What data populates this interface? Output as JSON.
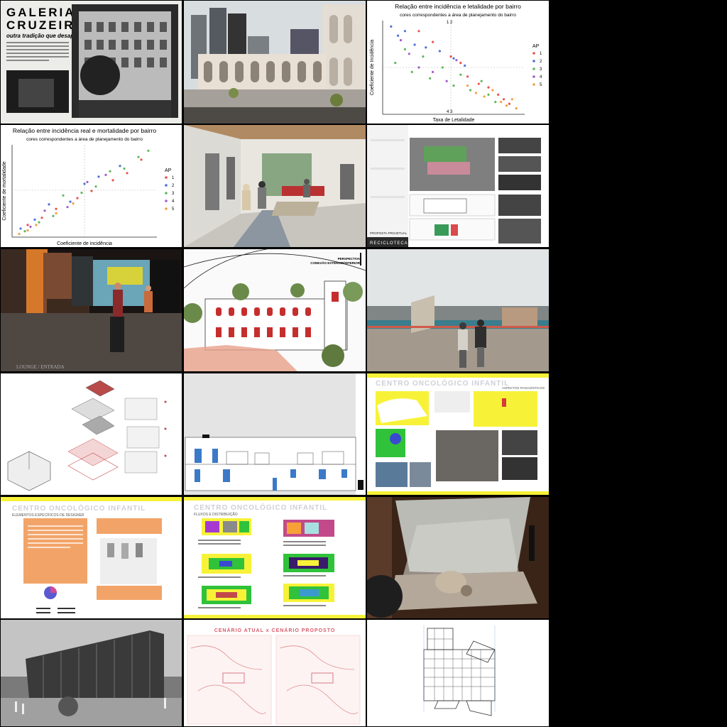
{
  "tiles": {
    "galeria": {
      "title_line1": "GALERIA",
      "title_line2": "CRUZEIRO",
      "subtitle": "outra tradição que desaparece"
    },
    "chart1": {
      "title": "Relação entre incidência e letalidade por bairro",
      "subtitle": "cores correspondentes a área de planejamento do bairro",
      "xlabel": "Taxa de Letalidade",
      "ylabel": "Coeficiente de Incidência",
      "quad_top": "1   2",
      "quad_bottom": "4   3",
      "legend_title": "AP",
      "legend": [
        "1",
        "2",
        "3",
        "4",
        "5"
      ]
    },
    "chart2": {
      "title": "Relação entre incidência real e mortalidade por bairro",
      "subtitle": "cores correspondentes a área de planejamento do bairro",
      "xlabel": "Coeficiente de incidência",
      "ylabel": "Coeficiente de mortalidade",
      "legend_title": "AP",
      "legend": [
        "1",
        "2",
        "3",
        "4",
        "5"
      ]
    },
    "reciclo": {
      "label": "RECICLOTECA",
      "section_label": "PROPOSTA PROJETUAL"
    },
    "lobby": {
      "caption": "LOUNGE / ENTRADA"
    },
    "perspective": {
      "label": "PERSPECTIVA\nCONEXÃO EXTERIOR/INTERIOR"
    },
    "onco1": {
      "title": "CENTRO ONCOLÓGICO INFANTIL",
      "section": "ASPECTOS PAISAGÍSTICOS"
    },
    "onco2": {
      "title": "CENTRO ONCOLÓGICO INFANTIL",
      "section": "ELEMENTOS ESPECÍFICOS DE DESIGNER"
    },
    "onco3": {
      "title": "CENTRO ONCOLÓGICO INFANTIL",
      "section": "FLUXOS E DISTRIBUIÇÃO"
    },
    "cenario": {
      "title": "CENÁRIO ATUAL  x  CENÁRIO PROPOSTO"
    }
  },
  "colors": {
    "ap": [
      "#e8534a",
      "#4c72d8",
      "#5fb85a",
      "#a35cc9",
      "#f0a040"
    ],
    "onco_yellow": "#f7f238",
    "onco_title": "#cfcfd8"
  },
  "chart_data": [
    {
      "type": "scatter",
      "title": "Relação entre incidência e letalidade por bairro",
      "xlabel": "Taxa de Letalidade",
      "ylabel": "Coeficiente de Incidência",
      "legend_title": "AP",
      "series": [
        {
          "name": "1",
          "x": [
            0.25,
            0.35,
            0.48,
            0.55,
            0.6,
            0.68,
            0.75,
            0.82,
            0.86,
            0.9
          ],
          "y": [
            0.9,
            0.78,
            0.62,
            0.55,
            0.4,
            0.32,
            0.28,
            0.2,
            0.15,
            0.1
          ]
        },
        {
          "name": "2",
          "x": [
            0.05,
            0.1,
            0.15,
            0.22,
            0.3,
            0.4,
            0.5,
            0.58
          ],
          "y": [
            0.95,
            0.85,
            0.9,
            0.75,
            0.72,
            0.68,
            0.6,
            0.52
          ]
        },
        {
          "name": "3",
          "x": [
            0.08,
            0.15,
            0.2,
            0.28,
            0.33,
            0.42,
            0.5,
            0.55,
            0.62,
            0.7,
            0.75,
            0.8
          ],
          "y": [
            0.55,
            0.7,
            0.45,
            0.62,
            0.38,
            0.5,
            0.3,
            0.42,
            0.25,
            0.35,
            0.2,
            0.12
          ]
        },
        {
          "name": "4",
          "x": [
            0.12,
            0.18,
            0.25,
            0.35,
            0.45,
            0.52
          ],
          "y": [
            0.8,
            0.65,
            0.5,
            0.45,
            0.35,
            0.58
          ]
        },
        {
          "name": "5",
          "x": [
            0.6,
            0.66,
            0.72,
            0.78,
            0.84,
            0.88,
            0.92,
            0.95
          ],
          "y": [
            0.3,
            0.22,
            0.18,
            0.25,
            0.12,
            0.08,
            0.15,
            0.05
          ]
        }
      ]
    },
    {
      "type": "scatter",
      "title": "Relação entre incidência real e mortalidade por bairro",
      "xlabel": "Coeficiente de incidência",
      "ylabel": "Coeficiente de mortalidade",
      "legend_title": "AP",
      "series": [
        {
          "name": "1",
          "x": [
            0.1,
            0.2,
            0.3,
            0.45,
            0.55,
            0.7,
            0.8,
            0.9
          ],
          "y": [
            0.12,
            0.2,
            0.3,
            0.42,
            0.5,
            0.62,
            0.7,
            0.85
          ]
        },
        {
          "name": "2",
          "x": [
            0.05,
            0.15,
            0.25,
            0.4,
            0.5,
            0.6,
            0.75
          ],
          "y": [
            0.08,
            0.18,
            0.35,
            0.38,
            0.58,
            0.66,
            0.78
          ]
        },
        {
          "name": "3",
          "x": [
            0.08,
            0.18,
            0.28,
            0.35,
            0.48,
            0.58,
            0.68,
            0.78,
            0.88,
            0.95
          ],
          "y": [
            0.05,
            0.15,
            0.22,
            0.45,
            0.48,
            0.55,
            0.72,
            0.75,
            0.88,
            0.95
          ]
        },
        {
          "name": "4",
          "x": [
            0.12,
            0.22,
            0.38,
            0.52,
            0.65
          ],
          "y": [
            0.1,
            0.28,
            0.32,
            0.6,
            0.68
          ]
        },
        {
          "name": "5",
          "x": [
            0.04,
            0.1,
            0.16,
            0.3,
            0.42
          ],
          "y": [
            0.02,
            0.06,
            0.12,
            0.25,
            0.36
          ]
        }
      ]
    }
  ]
}
